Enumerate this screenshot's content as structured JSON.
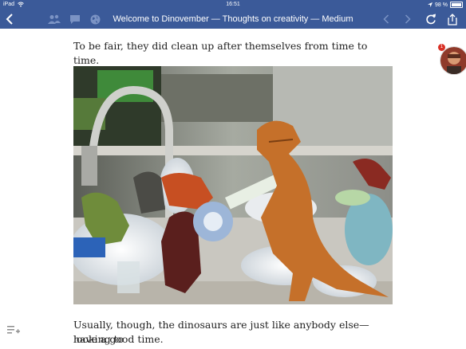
{
  "status_bar": {
    "device": "iPad",
    "time": "16:51",
    "battery": "98 %"
  },
  "nav_bar": {
    "title": "Welcome to Dinovember — Thoughts on creativity — Medium",
    "icons": [
      "back-icon",
      "friends-icon",
      "chat-icon",
      "globe-icon",
      "prev-icon",
      "next-icon",
      "reload-icon",
      "share-icon"
    ]
  },
  "article": {
    "para_top": "To be fair, they did clean up after themselves from time to time.",
    "para_bottom_line1": "Usually, though, the dinosaurs are just like anybody else—looking to",
    "para_bottom_line2": "have a good time."
  },
  "avatar": {
    "badge_count": "1"
  },
  "colors": {
    "nav_bg": "#3b5a99",
    "text": "#1f1f1f",
    "badge": "#d93025"
  }
}
